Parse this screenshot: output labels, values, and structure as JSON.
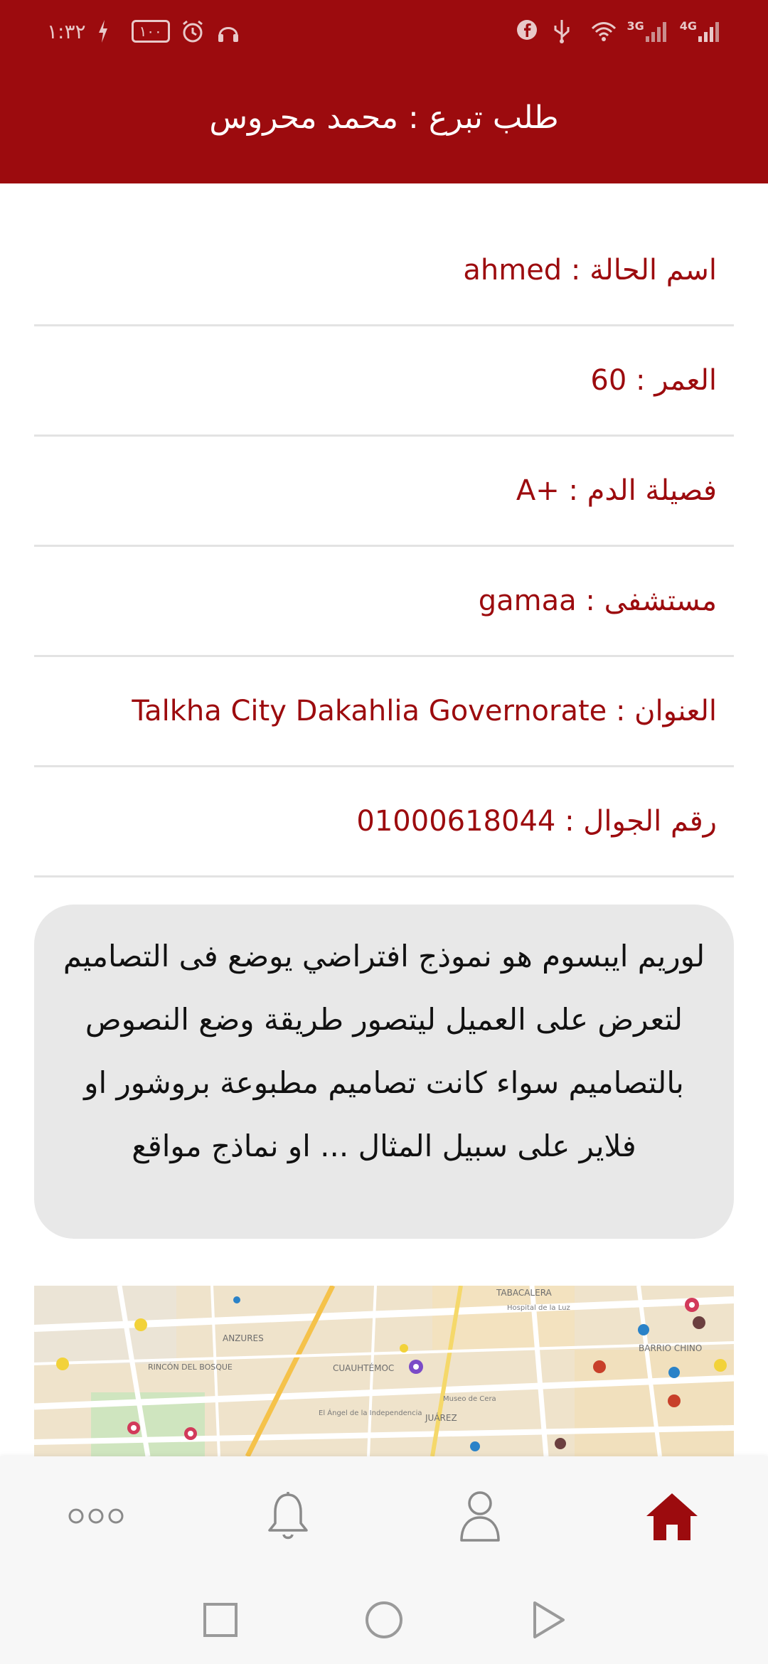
{
  "status_bar": {
    "time": "١:٣٢",
    "battery": "١٠٠",
    "network_3g": "3G",
    "network_4g": "4G"
  },
  "header": {
    "title": "طلب تبرع : محمد محروس"
  },
  "info_rows": [
    {
      "text": "اسم الحالة : ahmed"
    },
    {
      "text": "العمر : 60"
    },
    {
      "text": "فصيلة الدم : +A"
    },
    {
      "text": "مستشفى : gamaa"
    },
    {
      "text": "العنوان : Talkha City Dakahlia Governorate"
    },
    {
      "text": "رقم الجوال : 01000618044"
    }
  ],
  "description": "لوريم ايبسوم هو نموذج افتراضي يوضع فى التصاميم لتعرض على العميل ليتصور طريقة وضع النصوص بالتصاميم سواء كانت تصاميم مطبوعة بروشور او فلاير على سبيل المثال ... او نماذج مواقع",
  "map": {
    "labels": [
      "TABACALERA",
      "ANZURES",
      "RINCÓN DEL BOSQUE",
      "CUAUHTÉMOC",
      "JUÁREZ",
      "BARRIO CHINO",
      "Hospital de la Luz",
      "Museo de Cera",
      "El Ángel de la Independencia"
    ]
  },
  "bottom_nav": {
    "items": [
      {
        "name": "more",
        "icon": "more-dots-icon"
      },
      {
        "name": "notifications",
        "icon": "bell-icon"
      },
      {
        "name": "profile",
        "icon": "person-icon"
      },
      {
        "name": "home",
        "icon": "home-icon",
        "active": true
      }
    ]
  },
  "colors": {
    "primary": "#9c0b0e",
    "text_red": "#9c0b0e",
    "bubble_bg": "#e8e8e8",
    "nav_bg": "#f7f7f7",
    "inactive_icon": "#8a8a8a"
  }
}
